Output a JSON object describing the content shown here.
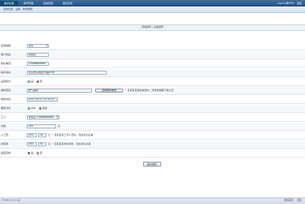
{
  "header": {
    "nav": [
      "事务处理",
      "帐号管理",
      "系统管理",
      "报表查询"
    ],
    "user": "admin(李宁宁)",
    "logout": "退出"
  },
  "breadcrumb": "您的位置：设备 - 新增报修",
  "form_heading": "添加报修 | 设备报修",
  "form": {
    "district": {
      "label": "区域选择:",
      "value": "北京"
    },
    "customer_name": {
      "label": "客户姓名:",
      "value": "张先生"
    },
    "contact_phone": {
      "label": "联系电话:",
      "value": "13988888888"
    },
    "contact_address": {
      "label": "联系地址:",
      "value": "北京市东城区XX路XX号"
    },
    "urgent": {
      "label": "是否加急:",
      "options": [
        "是",
        "否"
      ],
      "selected": "否"
    },
    "repair_item": {
      "label": "报修项目:",
      "value": "燃气报修",
      "button": "选择报修类型",
      "hint": "该项目有报修类型时，所有数据都不能为空"
    },
    "repair_time": {
      "label": "报修时间:",
      "value": "2013-08-14 15:46:02"
    },
    "repair_method": {
      "label": "报修方式:",
      "options": [
        "APP",
        "电话"
      ],
      "selected": "电话"
    },
    "worker": {
      "label": "工人:",
      "value": "李先生 13988888888"
    },
    "price": {
      "label": "价格:",
      "value": "200",
      "unit": "元"
    },
    "labor_fee": {
      "label": "人工费:",
      "value1": "200",
      "value2": "12",
      "unit": "元",
      "hint": "该项目有工作人员时，则此项为必填"
    },
    "material_fee": {
      "label": "材料费:",
      "value1": "200",
      "value2": "30",
      "unit": "元",
      "hint": "该项目有材料费时，则此项为必填"
    },
    "order_completed": {
      "label": "是否完成:",
      "options": [
        "是",
        "否"
      ],
      "selected": "是"
    }
  },
  "submit_label": "提交保存",
  "footer": {
    "left": "©2013 xxx.net",
    "links": [
      "返回首页",
      "退出"
    ]
  }
}
